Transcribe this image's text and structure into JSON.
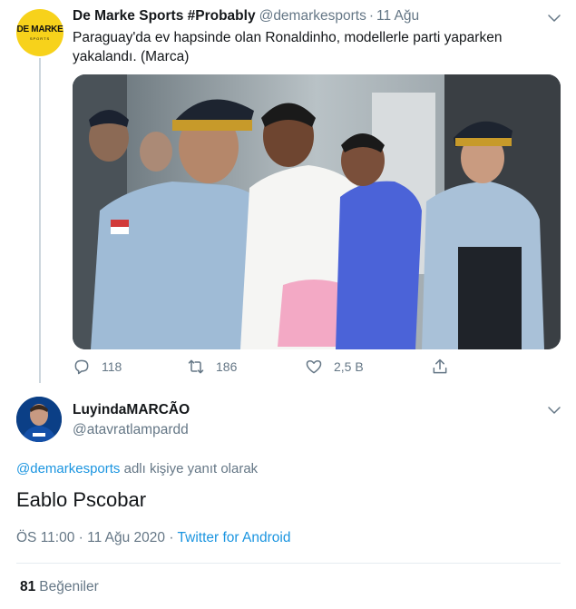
{
  "tweet": {
    "avatar_text": "DE MARKE",
    "avatar_subtext": "SPORTS",
    "display_name": "De Marke Sports #Probably",
    "handle": "@demarkesports",
    "separator": "·",
    "date": "11 Ağu",
    "text": "Paraguay'da ev hapsinde olan Ronaldinho, modellerle parti yaparken yakalandı. (Marca)",
    "actions": {
      "reply_count": "118",
      "retweet_count": "186",
      "like_count": "2,5 B"
    }
  },
  "reply": {
    "display_name": "LuyindaMARCÃO",
    "handle": "@atavratlampardd",
    "replying_mention": "@demarkesports",
    "replying_suffix": " adlı kişiye yanıt olarak",
    "text": "Eablo Pscobar",
    "time": "ÖS 11:00",
    "date": "11 Ağu 2020",
    "separator": " · ",
    "source": "Twitter for Android",
    "likes_count": "81",
    "likes_label": "Beğeniler"
  },
  "colors": {
    "accent": "#1b95e0",
    "muted": "#657786",
    "text": "#14171a",
    "divider": "#e6ecf0",
    "brand_yellow": "#f7d21b"
  },
  "icons": [
    "chevron-down-icon",
    "reply-icon",
    "retweet-icon",
    "heart-icon",
    "share-icon"
  ]
}
